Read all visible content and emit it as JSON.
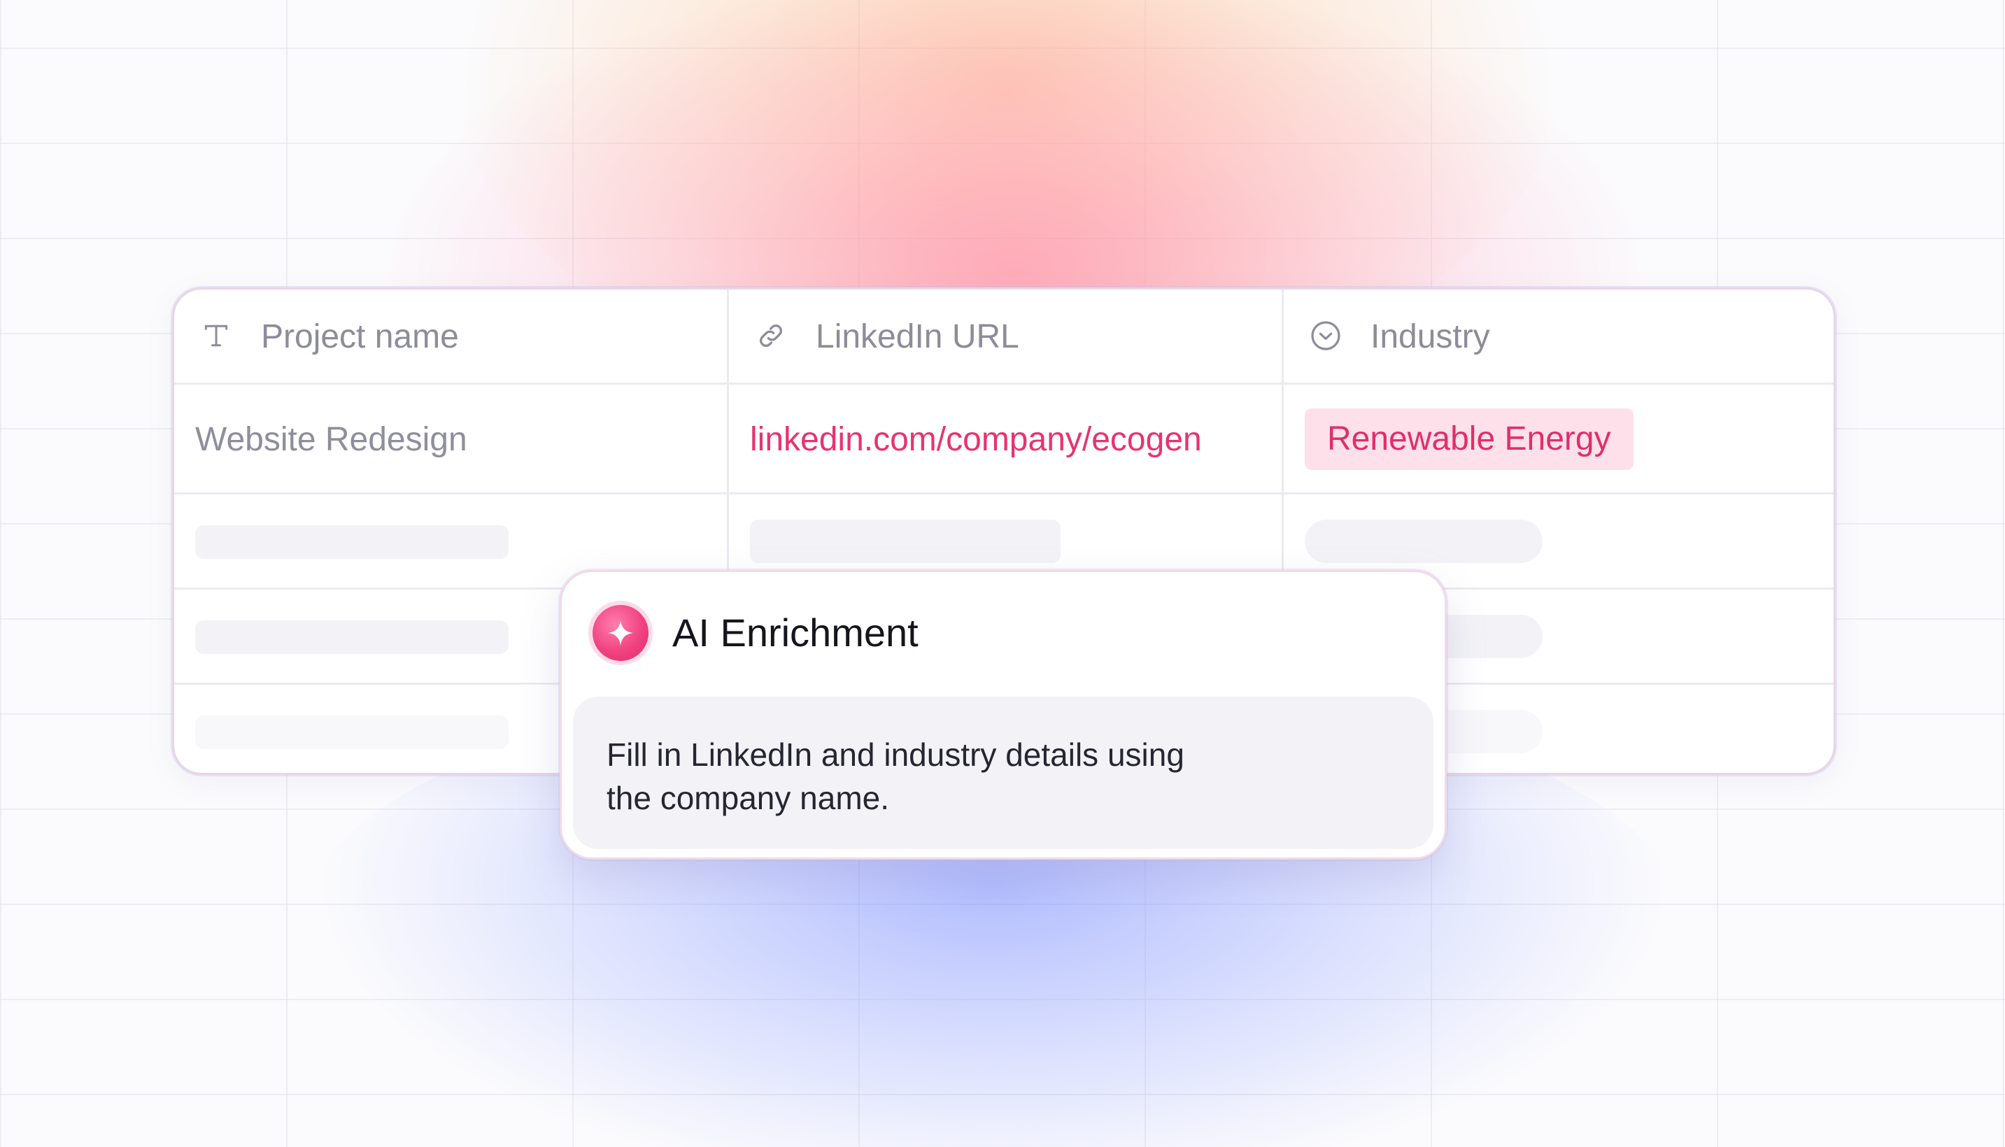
{
  "table": {
    "columns": [
      {
        "label": "Project name",
        "icon": "text-type-icon"
      },
      {
        "label": "LinkedIn URL",
        "icon": "link-icon"
      },
      {
        "label": "Industry",
        "icon": "select-chevron-icon"
      }
    ],
    "row": {
      "project_name": "Website Redesign",
      "linkedin_url": "linkedin.com/company/ecogen",
      "industry": "Renewable Energy"
    }
  },
  "popup": {
    "icon": "sparkle-icon",
    "title": "AI Enrichment",
    "body_line1": "Fill in LinkedIn and industry details using",
    "body_line2": "the company name."
  },
  "colors": {
    "accent": "#e8336f",
    "badge_bg": "#fde0ea",
    "muted_text": "#8c8c9a"
  }
}
